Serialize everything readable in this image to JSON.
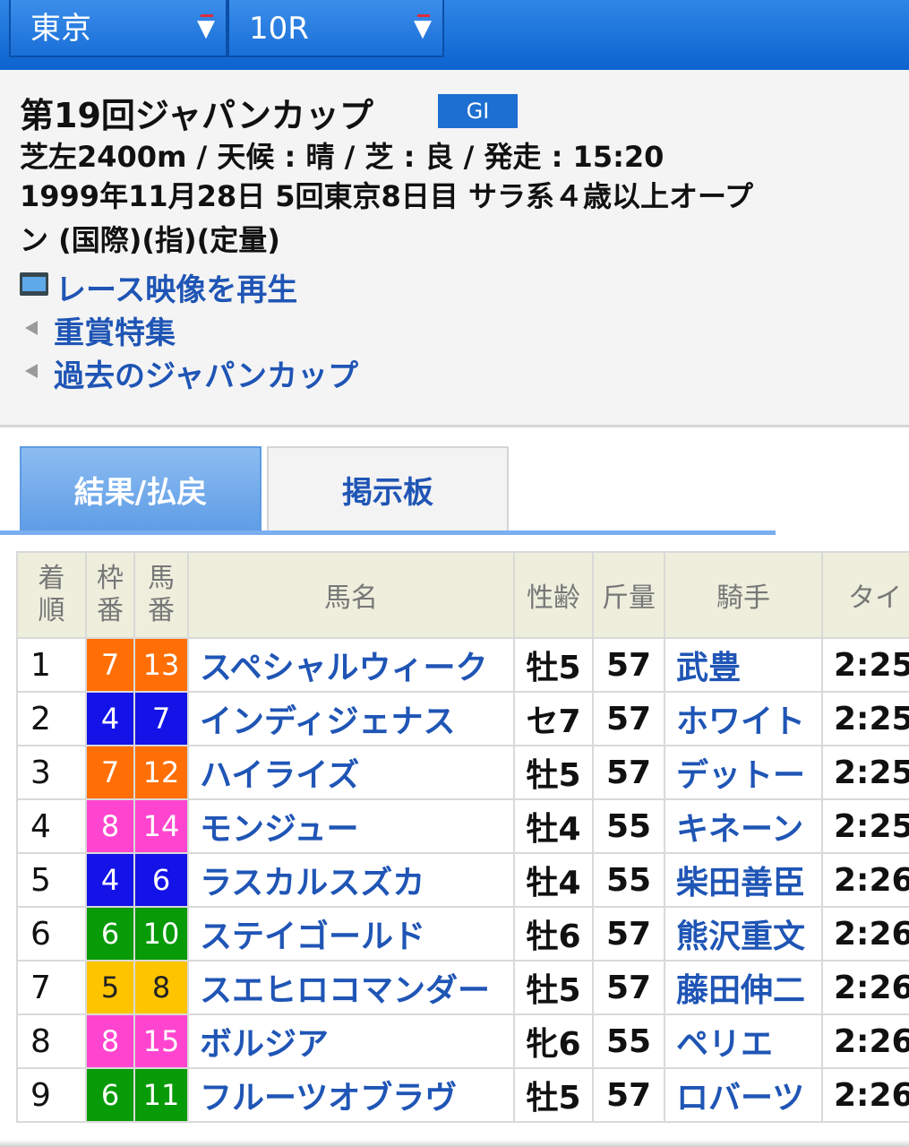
{
  "colors": {
    "frame": {
      "1": "#ffffff",
      "2": "#111111",
      "3": "#e32727",
      "4": "#1313e8",
      "5": "#ffc400",
      "6": "#079b07",
      "7": "#ff6f05",
      "8": "#ff45cf"
    },
    "frame_text": {
      "5": "#222222",
      "default": "#ffffff"
    }
  },
  "header": {
    "venue_select": {
      "value": "東京",
      "icon": "dropdown-arrow-icon"
    },
    "race_select": {
      "value": "10R",
      "icon": "dropdown-arrow-icon"
    }
  },
  "race": {
    "title": "第19回ジャパンカップ",
    "grade": "GI",
    "conditions": "芝左2400m / 天候 : 晴 / 芝 : 良 / 発走 : 15:20",
    "date_line1": "1999年11月28日 5回東京8日目 サラ系４歳以上オープ",
    "date_line2": "ン  (国際)(指)(定量)"
  },
  "links": {
    "video": "レース映像を再生",
    "graded": "重賞特集",
    "past": "過去のジャパンカップ"
  },
  "tabs": {
    "results": "結果/払戻",
    "board": "掲示板"
  },
  "table": {
    "headers": {
      "pos": [
        "着",
        "順"
      ],
      "frame": [
        "枠",
        "番"
      ],
      "num": [
        "馬",
        "番"
      ],
      "horse": "馬名",
      "sex_age": "性齢",
      "weight": "斤量",
      "jockey": "騎手",
      "time": "タイ"
    },
    "rows": [
      {
        "pos": "1",
        "frame": "7",
        "num": "13",
        "horse": "スペシャルウィーク",
        "sex_age": "牡5",
        "weight": "57",
        "jockey": "武豊",
        "time": "2:25"
      },
      {
        "pos": "2",
        "frame": "4",
        "num": "7",
        "horse": "インディジェナス",
        "sex_age": "セ7",
        "weight": "57",
        "jockey": "ホワイト",
        "time": "2:25"
      },
      {
        "pos": "3",
        "frame": "7",
        "num": "12",
        "horse": "ハイライズ",
        "sex_age": "牡5",
        "weight": "57",
        "jockey": "デットー",
        "time": "2:25"
      },
      {
        "pos": "4",
        "frame": "8",
        "num": "14",
        "horse": "モンジュー",
        "sex_age": "牡4",
        "weight": "55",
        "jockey": "キネーン",
        "time": "2:25"
      },
      {
        "pos": "5",
        "frame": "4",
        "num": "6",
        "horse": "ラスカルスズカ",
        "sex_age": "牡4",
        "weight": "55",
        "jockey": "柴田善臣",
        "time": "2:26"
      },
      {
        "pos": "6",
        "frame": "6",
        "num": "10",
        "horse": "ステイゴールド",
        "sex_age": "牡6",
        "weight": "57",
        "jockey": "熊沢重文",
        "time": "2:26"
      },
      {
        "pos": "7",
        "frame": "5",
        "num": "8",
        "horse": "スエヒロコマンダー",
        "sex_age": "牡5",
        "weight": "57",
        "jockey": "藤田伸二",
        "time": "2:26"
      },
      {
        "pos": "8",
        "frame": "8",
        "num": "15",
        "horse": "ボルジア",
        "sex_age": "牝6",
        "weight": "55",
        "jockey": "ペリエ",
        "time": "2:26"
      },
      {
        "pos": "9",
        "frame": "6",
        "num": "11",
        "horse": "フルーツオブラヴ",
        "sex_age": "牡5",
        "weight": "57",
        "jockey": "ロバーツ",
        "time": "2:26"
      }
    ]
  }
}
